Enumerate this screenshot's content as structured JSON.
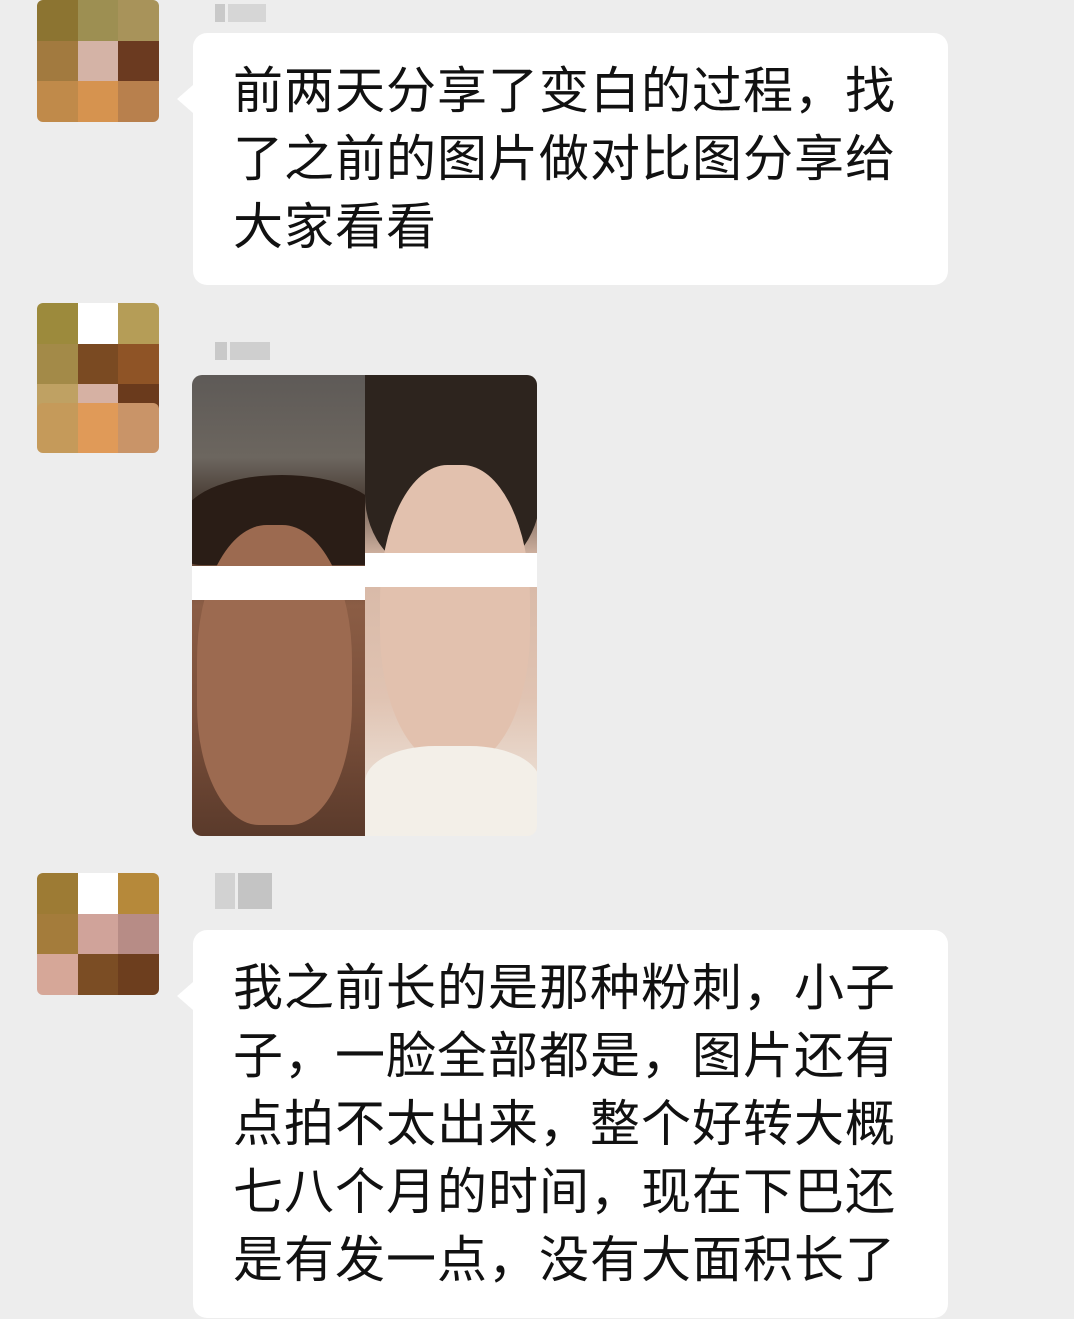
{
  "messages": [
    {
      "type": "text",
      "text": "前两天分享了变白的过程，找了之前的图片做对比图分享给大家看看"
    },
    {
      "type": "image",
      "image_desc": "before-after-face-comparison"
    },
    {
      "type": "text",
      "text": "我之前长的是那种粉刺，小子子，一脸全部都是，图片还有点拍不太出来，整个好转大概七八个月的时间，现在下巴还是有发一点，没有大面积长了"
    }
  ],
  "colors": {
    "background": "#ededed",
    "bubble": "#ffffff",
    "text": "#111111"
  }
}
